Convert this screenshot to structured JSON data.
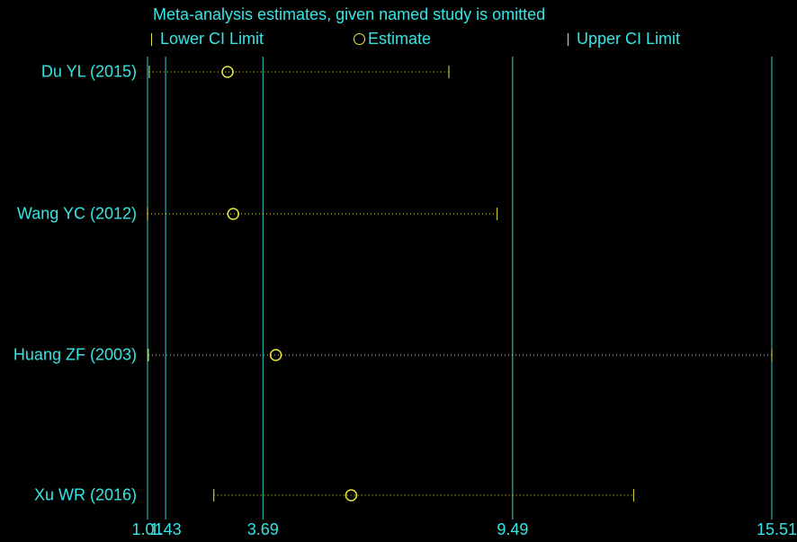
{
  "chart_data": {
    "type": "scatter",
    "title": "Meta-analysis estimates, given named study is omitted",
    "legend": {
      "position": "top",
      "entries": [
        "Lower CI Limit",
        "Estimate",
        "Upper CI Limit"
      ]
    },
    "xlim": [
      1.01,
      15.51
    ],
    "x_ticks": [
      "1.01",
      "1.43",
      "3.69",
      "9.49",
      "15.51"
    ],
    "x_tick_values": [
      1.01,
      1.43,
      3.69,
      9.49,
      15.51
    ],
    "reference_lines": [
      1.01,
      1.43,
      3.69,
      9.49,
      15.51
    ],
    "grid": false,
    "studies": [
      {
        "label": "Du YL (2015)",
        "lower": 1.05,
        "estimate": 2.87,
        "upper": 8.01
      },
      {
        "label": "Wang YC (2012)",
        "lower": 1.01,
        "estimate": 3.0,
        "upper": 9.13
      },
      {
        "label": "Huang ZF (2003)",
        "lower": 1.03,
        "estimate": 3.99,
        "upper": 15.51
      },
      {
        "label": "Xu WR (2016)",
        "lower": 2.55,
        "estimate": 5.74,
        "upper": 12.3
      }
    ],
    "colors": {
      "background": "#000000",
      "text": "#33e6e6",
      "reference_line": "#2ad3cf",
      "marker": "#e8e83a",
      "ci_line": "#e8e83a"
    }
  }
}
